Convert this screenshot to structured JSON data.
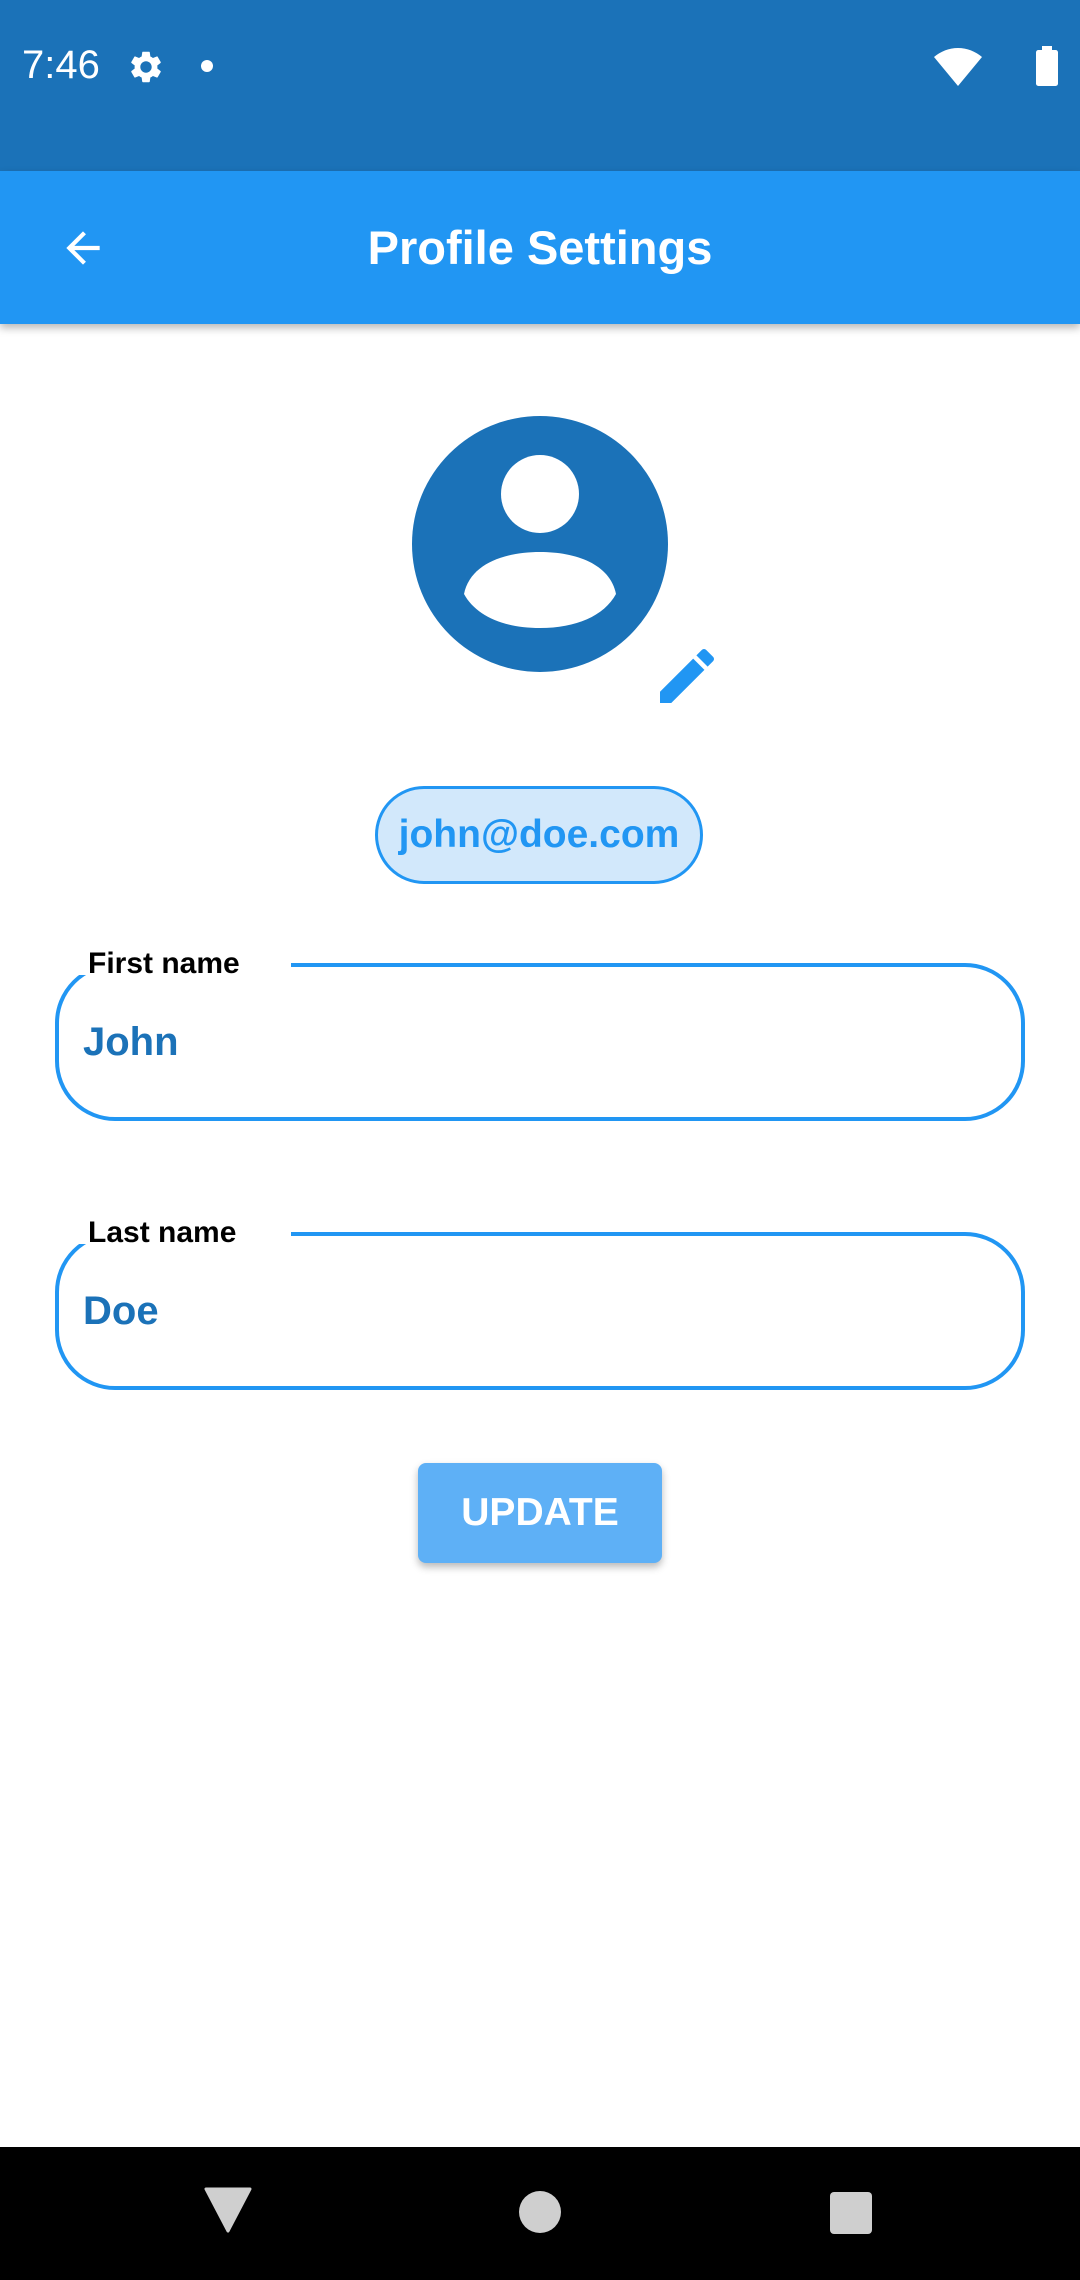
{
  "status_bar": {
    "time": "7:46",
    "icons": [
      "gear-icon",
      "dot-icon",
      "wifi-icon",
      "battery-icon"
    ]
  },
  "app_bar": {
    "title": "Profile Settings",
    "back_icon": "arrow-back-icon"
  },
  "profile": {
    "avatar_icon": "account-circle-icon",
    "edit_icon": "pencil-icon",
    "email": "john@doe.com"
  },
  "form": {
    "first_name": {
      "label": "First name",
      "value": "John"
    },
    "last_name": {
      "label": "Last name",
      "value": "Doe"
    },
    "submit_label": "UPDATE"
  },
  "navigation_bar": {
    "icons": [
      "nav-back-icon",
      "nav-home-icon",
      "nav-recents-icon"
    ]
  },
  "colors": {
    "status_bar": "#1b72b8",
    "app_bar": "#2196f3",
    "accent": "#2196f3",
    "text_value": "#1b72b8",
    "button": "#5eb0f6",
    "chip_background": "#d2e8fb"
  }
}
